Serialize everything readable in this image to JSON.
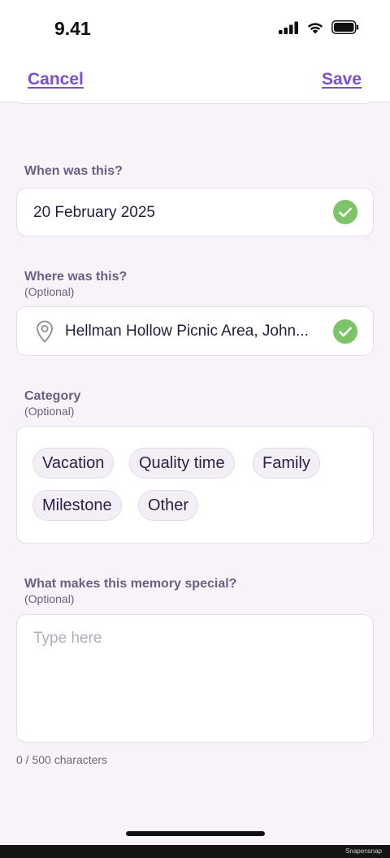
{
  "status_bar": {
    "time": "9.41",
    "icons": [
      "signal-icon",
      "wifi-icon",
      "battery-icon"
    ]
  },
  "nav": {
    "cancel_label": "Cancel",
    "save_label": "Save"
  },
  "date_section": {
    "label": "When was this?",
    "value": "20 February 2025",
    "valid": true
  },
  "location_section": {
    "label": "Where was this?",
    "optional": "(Optional)",
    "value": "Hellman Hollow Picnic Area, John...",
    "valid": true
  },
  "category_section": {
    "label": "Category",
    "optional": "(Optional)",
    "chips": [
      "Vacation",
      "Quality time",
      "Family",
      "Milestone",
      "Other"
    ]
  },
  "special_section": {
    "label": "What makes this memory special?",
    "optional": "(Optional)",
    "placeholder": "Type here",
    "value": "",
    "char_count": "0 / 500 characters"
  },
  "watermark": "Snapensnap",
  "colors": {
    "accent": "#7b50c9",
    "success": "#7cc36a",
    "background": "#f7f3f9",
    "label": "#6b5f86"
  }
}
